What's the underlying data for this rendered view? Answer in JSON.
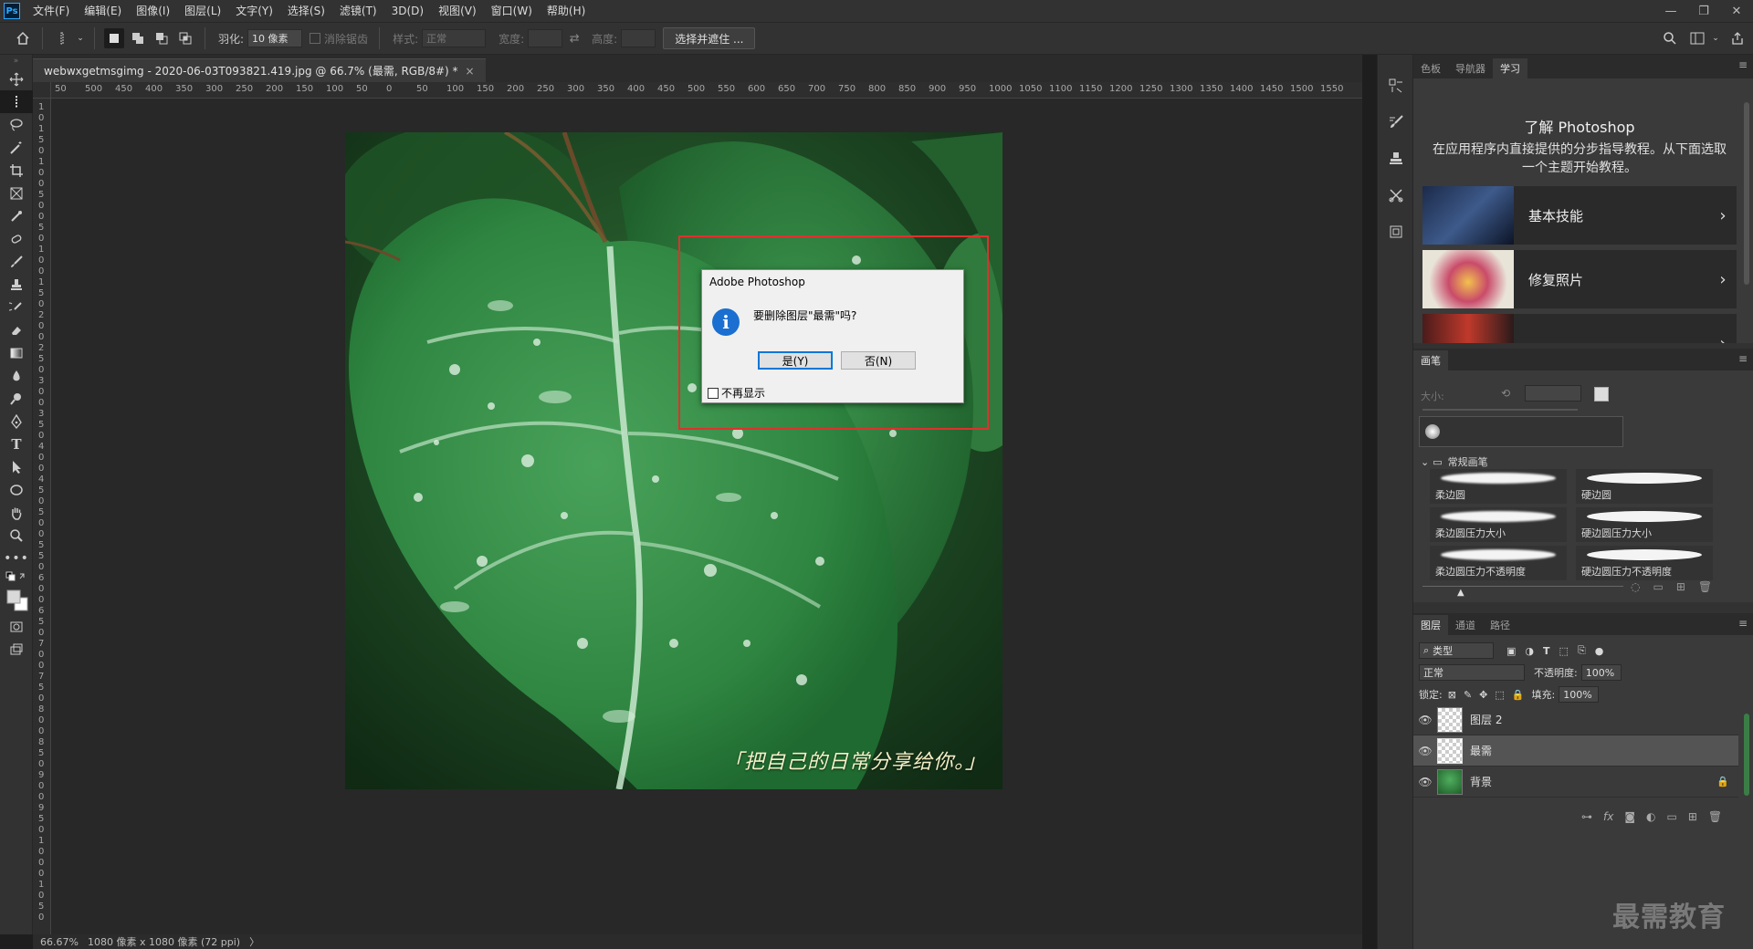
{
  "app": {
    "logo": "Ps"
  },
  "menu": [
    "文件(F)",
    "编辑(E)",
    "图像(I)",
    "图层(L)",
    "文字(Y)",
    "选择(S)",
    "滤镜(T)",
    "3D(D)",
    "视图(V)",
    "窗口(W)",
    "帮助(H)"
  ],
  "options": {
    "feather_label": "羽化:",
    "feather_value": "10 像素",
    "antialias_label": "消除锯齿",
    "style_label": "样式:",
    "style_value": "正常",
    "width_label": "宽度:",
    "height_label": "高度:",
    "select_mask_button": "选择并遮住 ..."
  },
  "document": {
    "tab_title": "webwxgetmsgimg - 2020-06-03T093821.419.jpg @ 66.7% (最需, RGB/8#) *",
    "tab_close": "×",
    "caption": "「把自己的日常分享给你。」"
  },
  "ruler": {
    "h_ticks": [
      "50",
      "500",
      "450",
      "400",
      "350",
      "300",
      "250",
      "200",
      "150",
      "100",
      "50",
      "0",
      "50",
      "100",
      "150",
      "200",
      "250",
      "300",
      "350",
      "400",
      "450",
      "500",
      "550",
      "600",
      "650",
      "700",
      "750",
      "800",
      "850",
      "900",
      "950",
      "1000",
      "1050",
      "1100",
      "1150",
      "1200",
      "1250",
      "1300",
      "1350",
      "1400",
      "1450",
      "1500",
      "1550"
    ],
    "v_ticks": [
      "1",
      "0",
      "1",
      "5",
      "0",
      "1",
      "0",
      "0",
      "5",
      "0",
      "0",
      "5",
      "0",
      "1",
      "0",
      "0",
      "1",
      "5",
      "0",
      "2",
      "0",
      "0",
      "2",
      "5",
      "0",
      "3",
      "0",
      "0",
      "3",
      "5",
      "0",
      "4",
      "0",
      "0",
      "4",
      "5",
      "0",
      "5",
      "0",
      "0",
      "5",
      "5",
      "0",
      "6",
      "0",
      "0",
      "6",
      "5",
      "0",
      "7",
      "0",
      "0",
      "7",
      "5",
      "0",
      "8",
      "0",
      "0",
      "8",
      "5",
      "0",
      "9",
      "0",
      "0",
      "9",
      "5",
      "0",
      "1",
      "0",
      "0",
      "0",
      "1",
      "0",
      "5",
      "0"
    ]
  },
  "dialog": {
    "title": "Adobe Photoshop",
    "icon": "i",
    "message": "要删除图层\"最需\"吗?",
    "yes_button": "是(Y)",
    "no_button": "否(N)",
    "checkbox_label": "不再显示"
  },
  "status": {
    "zoom": "66.67%",
    "info": "1080 像素 x 1080 像素 (72 ppi)",
    "arrow": "〉"
  },
  "learn_panel": {
    "tabs": [
      "色板",
      "导航器",
      "学习"
    ],
    "active_tab": 2,
    "title": "了解 Photoshop",
    "description": "在应用程序内直接提供的分步指导教程。从下面选取一个主题开始教程。",
    "cards": [
      {
        "label": "基本技能",
        "chevron": "›"
      },
      {
        "label": "修复照片",
        "chevron": "›"
      }
    ]
  },
  "brush_panel": {
    "tab": "画笔",
    "size_label": "大小:",
    "folder": "常规画笔",
    "brushes": [
      "柔边圆",
      "硬边圆",
      "柔边圆压力大小",
      "硬边圆压力大小",
      "柔边圆压力不透明度",
      "硬边圆压力不透明度"
    ]
  },
  "layers_panel": {
    "tabs": [
      "图层",
      "通道",
      "路径"
    ],
    "active_tab": 0,
    "filter_label": "类型",
    "blend_mode": "正常",
    "opacity_label": "不透明度:",
    "opacity_value": "100%",
    "lock_label": "锁定:",
    "fill_label": "填充:",
    "fill_value": "100%",
    "layers": [
      {
        "name": "图层 2",
        "selected": false,
        "locked": false,
        "thumb": "transparent"
      },
      {
        "name": "最需",
        "selected": true,
        "locked": false,
        "thumb": "transparent"
      },
      {
        "name": "背景",
        "selected": false,
        "locked": true,
        "thumb": "photo"
      }
    ],
    "footer_icons": [
      "link-icon",
      "fx-icon",
      "mask-icon",
      "adjustment-icon",
      "group-icon",
      "new-layer-icon",
      "trash-icon"
    ],
    "footer_fx": "fx"
  },
  "watermark": "最需教育",
  "colors": {
    "accent": "#31a8ff",
    "highlight_border": "#e0302d",
    "dialog_bg": "#f0f0f0",
    "info_icon": "#1a6fd0"
  }
}
